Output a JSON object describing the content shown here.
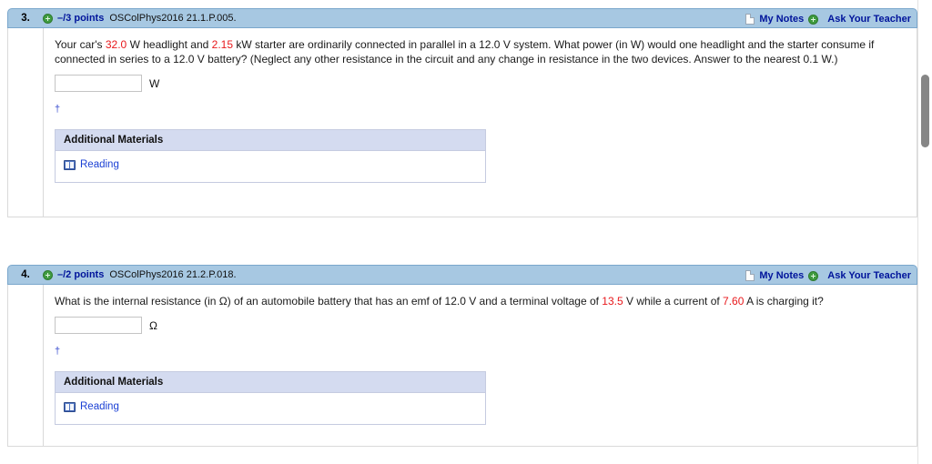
{
  "scrollbar": {
    "name": "vertical-scrollbar"
  },
  "questions": [
    {
      "number": "3.",
      "points": "–/3 points",
      "code": "OSColPhys2016 21.1.P.005.",
      "my_notes": "My Notes",
      "ask_teacher": "Ask Your Teacher",
      "prompt_parts": [
        {
          "text": "Your car's ",
          "highlight": false
        },
        {
          "text": "32.0",
          "highlight": true
        },
        {
          "text": " W headlight and ",
          "highlight": false
        },
        {
          "text": "2.15",
          "highlight": true
        },
        {
          "text": " kW starter are ordinarily connected in parallel in a 12.0 V system. What power (in W) would one headlight and the starter consume if connected in series to a 12.0 V battery? (Neglect any other resistance in the circuit and any change in resistance in the two devices. Answer to the nearest 0.1 W.)",
          "highlight": false
        }
      ],
      "answer_value": "",
      "answer_placeholder": "",
      "unit": "W",
      "footnote_symbol": "†",
      "additional_materials": {
        "title": "Additional Materials",
        "items": [
          {
            "label": "Reading",
            "icon": "book-icon"
          }
        ]
      }
    },
    {
      "number": "4.",
      "points": "–/2 points",
      "code": "OSColPhys2016 21.2.P.018.",
      "my_notes": "My Notes",
      "ask_teacher": "Ask Your Teacher",
      "prompt_parts": [
        {
          "text": "What is the internal resistance (in Ω) of an automobile battery that has an emf of 12.0 V and a terminal voltage of ",
          "highlight": false
        },
        {
          "text": "13.5",
          "highlight": true
        },
        {
          "text": " V while a current of ",
          "highlight": false
        },
        {
          "text": "7.60",
          "highlight": true
        },
        {
          "text": " A is charging it?",
          "highlight": false
        }
      ],
      "answer_value": "",
      "answer_placeholder": "",
      "unit": "Ω",
      "footnote_symbol": "†",
      "additional_materials": {
        "title": "Additional Materials",
        "items": [
          {
            "label": "Reading",
            "icon": "book-icon"
          }
        ]
      }
    }
  ],
  "colors": {
    "header_bar": "#a7c8e2",
    "link_blue": "#00149b",
    "highlight_red": "#e8191c",
    "materials_header": "#d4dbf0"
  }
}
